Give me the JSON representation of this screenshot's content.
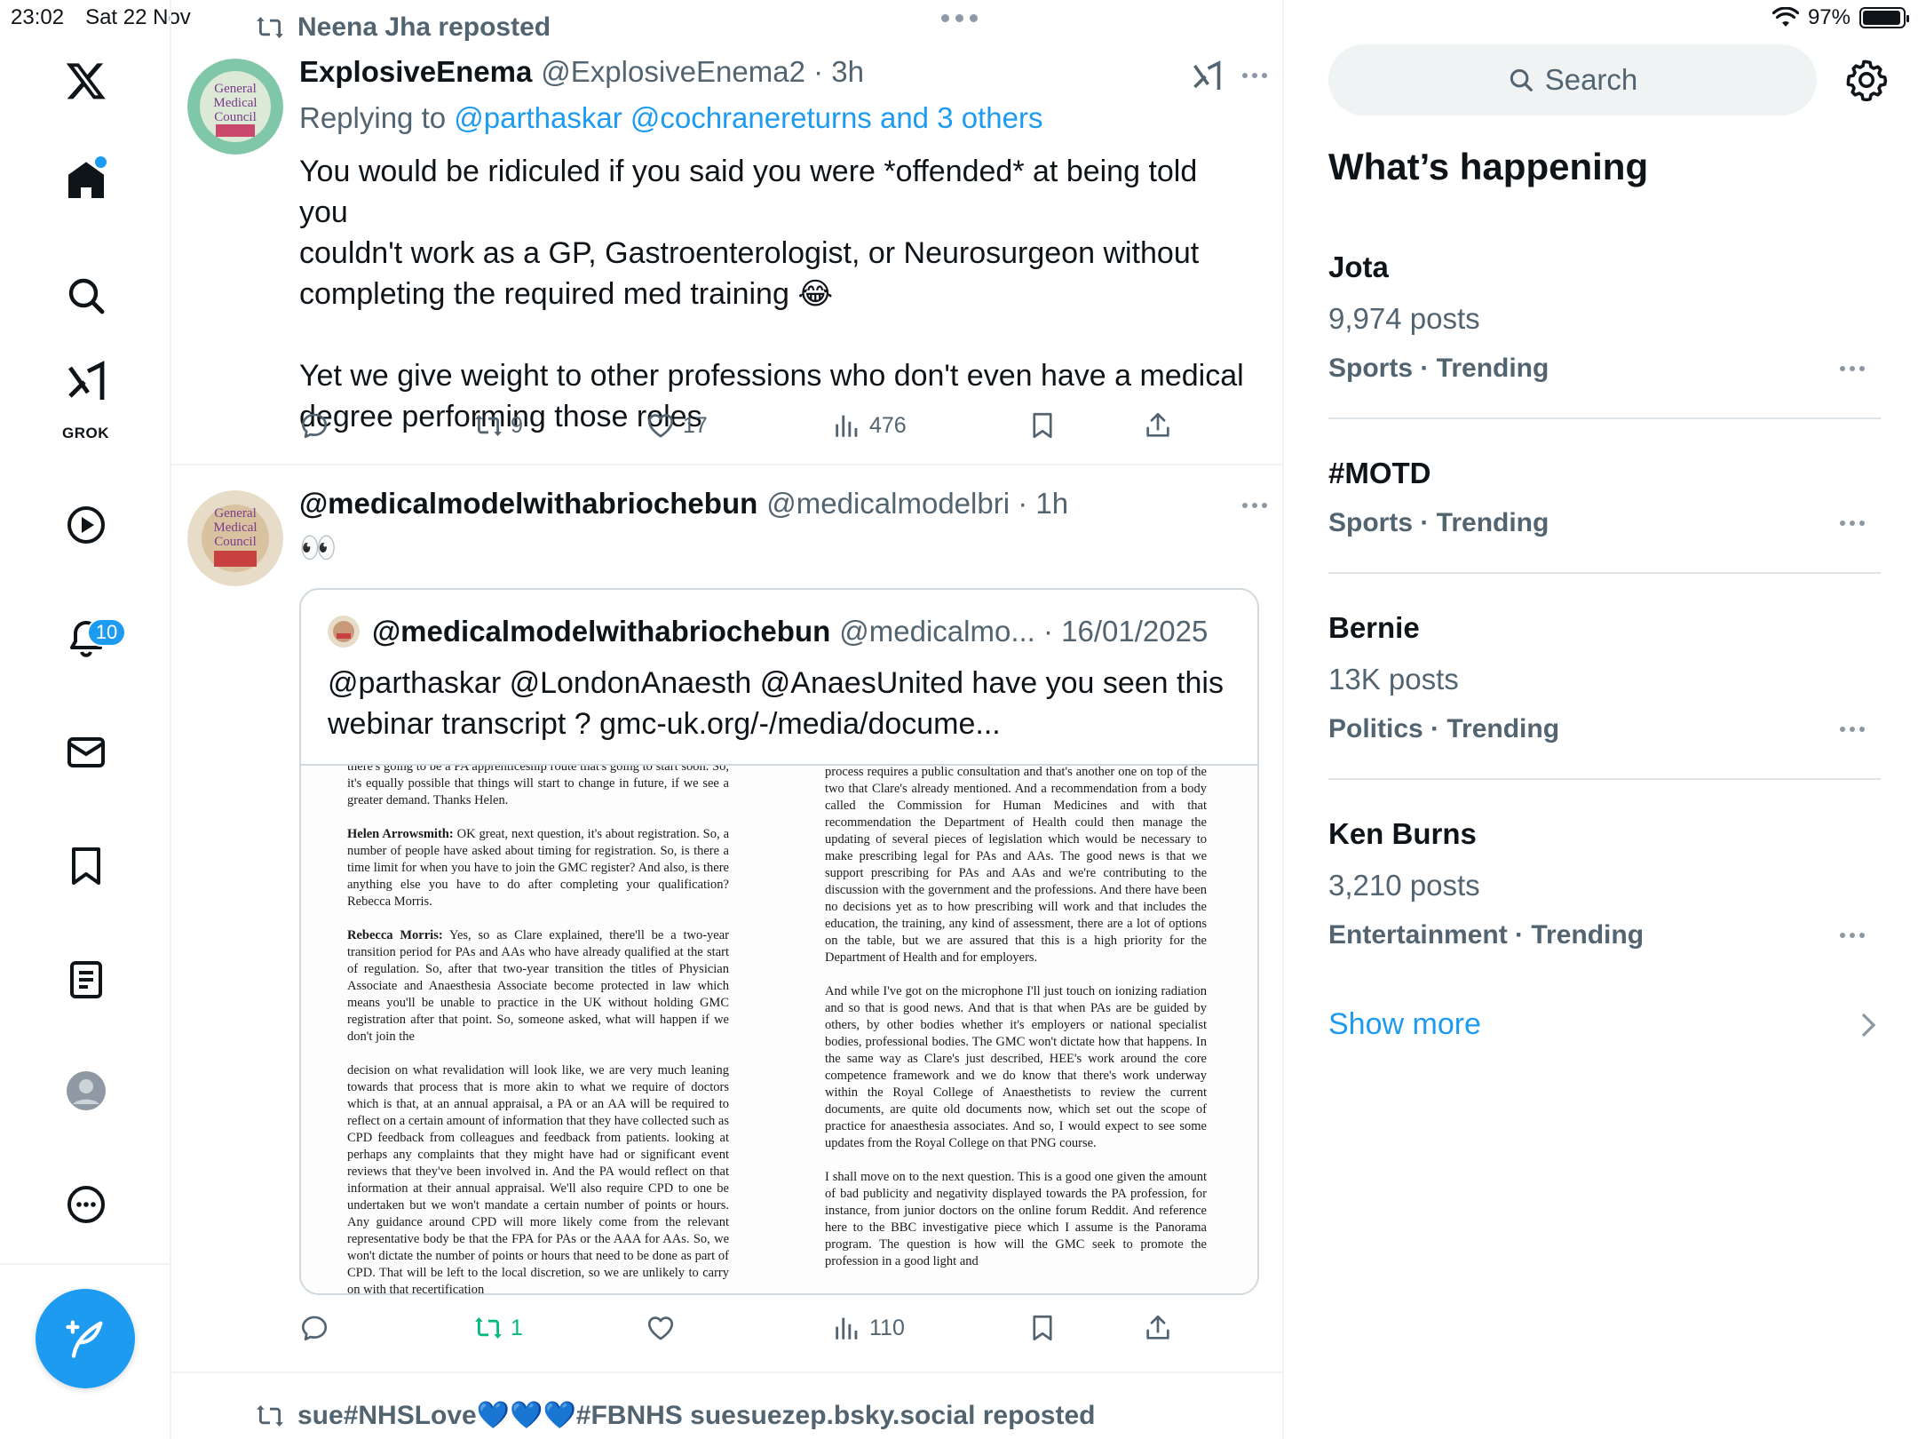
{
  "status_bar": {
    "time": "23:02",
    "date": "Sat 22 Nov",
    "battery": "97%",
    "battery_level": 0.97
  },
  "nav": {
    "grok_label": "GROK",
    "notifications_count": "10"
  },
  "tweets": [
    {
      "repost_by": "Neena Jha reposted",
      "name": "ExplosiveEnema",
      "handle": "@ExplosiveEnema2 · 3h",
      "replying_prefix": "Replying to ",
      "replying_to": "@parthaskar @cochranereturns and 3 others",
      "text_lines": [
        "You would be ridiculed if you said you were *offended* at being told you",
        "couldn't work as a GP, Gastroenterologist, or Neurosurgeon without",
        "completing the required med training 😂",
        "",
        "Yet we give weight to other professions who don't even have a medical",
        "degree performing those roles"
      ],
      "retweets": "9",
      "likes": "17",
      "views": "476"
    },
    {
      "name": "@medicalmodelwithabriochebun",
      "handle": "@medicalmodelbri · 1h",
      "text": "👀",
      "quote": {
        "name": "@medicalmodelwithabriochebun",
        "handle": "@medicalmo... · 16/01/2025",
        "text_lines": [
          "@parthaskar @LondonAnaesth @AnaesUnited  have you seen this",
          "webinar transcript ? gmc-uk.org/-/media/docume..."
        ],
        "doc_left": [
          "there's going to be a PA apprenticeship route that's going to start soon. So, it's equally possible that things will start to change in future, if we see a greater demand. Thanks Helen.",
          "Helen Arrowsmith:|| OK great, next question, it's about registration. So, a number of people have asked about timing for registration. So, is there a time limit for when you have to join the GMC register? And also, is there anything else you have to do after completing your qualification? Rebecca Morris.",
          "Rebecca Morris:|| Yes, so as Clare explained, there'll be a two-year transition period for PAs and AAs who have already qualified at the start of regulation. So, after that two-year transition the titles of Physician Associate and Anaesthesia Associate become protected in law which means you'll be unable to practice in the UK without holding GMC registration after that point. So, someone asked, what will happen if we don't join the",
          "decision on what revalidation will look like, we are very much leaning towards that process that is more akin to what we require of doctors which is that, at an annual appraisal, a PA or an AA will be required to reflect on a certain amount of information that they have collected such as CPD feedback from colleagues and feedback from patients. looking at perhaps any complaints that they might have had or significant event reviews that they've been involved in. And the PA would reflect on that information at their annual appraisal. We'll also require CPD to one be undertaken but we won't mandate a certain number of points or hours. Any guidance around CPD will more likely come from the relevant representative body be that the FPA for PAs or the AAA for AAs. So, we won't dictate the number of points or hours that need to be done as part of CPD. That will be left to the local discretion, so we are unlikely to carry on with that recertification"
        ],
        "doc_right": [
          "process requires a public consultation and that's another one on top of the two that Clare's already mentioned. And a recommendation from a body called the Commission for Human Medicines and with that recommendation the Department of Health could then manage the updating of several pieces of legislation which would be necessary to make prescribing legal for PAs and AAs. The good news is that we support prescribing for PAs and AAs and we're contributing to the discussion with the government and the professions. And there have been no decisions yet as to how prescribing will work and that includes the education, the training, any kind of assessment, there are a lot of options on the table, but we are assured that this is a high priority for the Department of Health and for employers.",
          "And while I've got on the microphone I'll just touch on ionizing radiation and so that is good news. And that is that when PAs are be guided by others, by other bodies whether it's employers or national specialist bodies, professional bodies. The GMC won't dictate how that happens. In the same way as Clare's just described, HEE's work around the core competence framework and we do know that there's work underway within the Royal College of Anaesthetists to review the current documents, are quite old documents now, which set out the scope of practice for anaesthesia associates. And so, I would expect to see some updates from the Royal College on that PNG course.",
          "I shall move on to the next question. This is a good one given the amount of bad publicity and negativity displayed towards the PA profession, for instance, from junior doctors on the online forum Reddit. And reference here to the BBC investigative piece which I assume is the Panorama program. The question is how will the GMC seek to promote the profession in a good light and"
        ]
      },
      "retweets": "1",
      "views": "110"
    }
  ],
  "next_repost": "sue#NHSLove💙💙💙#FBNHS suesuezep.bsky.social reposted",
  "sidebar": {
    "search_placeholder": "Search",
    "title": "What’s happening",
    "trends": [
      {
        "name": "Jota",
        "posts": "9,974 posts",
        "category": "Sports · Trending"
      },
      {
        "name": "#MOTD",
        "posts": "",
        "category": "Sports · Trending"
      },
      {
        "name": "Bernie",
        "posts": "13K posts",
        "category": "Politics · Trending"
      },
      {
        "name": "Ken Burns",
        "posts": "3,210 posts",
        "category": "Entertainment · Trending"
      }
    ],
    "show_more": "Show more"
  },
  "colors": {
    "accent": "#1d9bf0",
    "secondary_text": "#536471",
    "retweeted_green": "#00ba7c"
  }
}
